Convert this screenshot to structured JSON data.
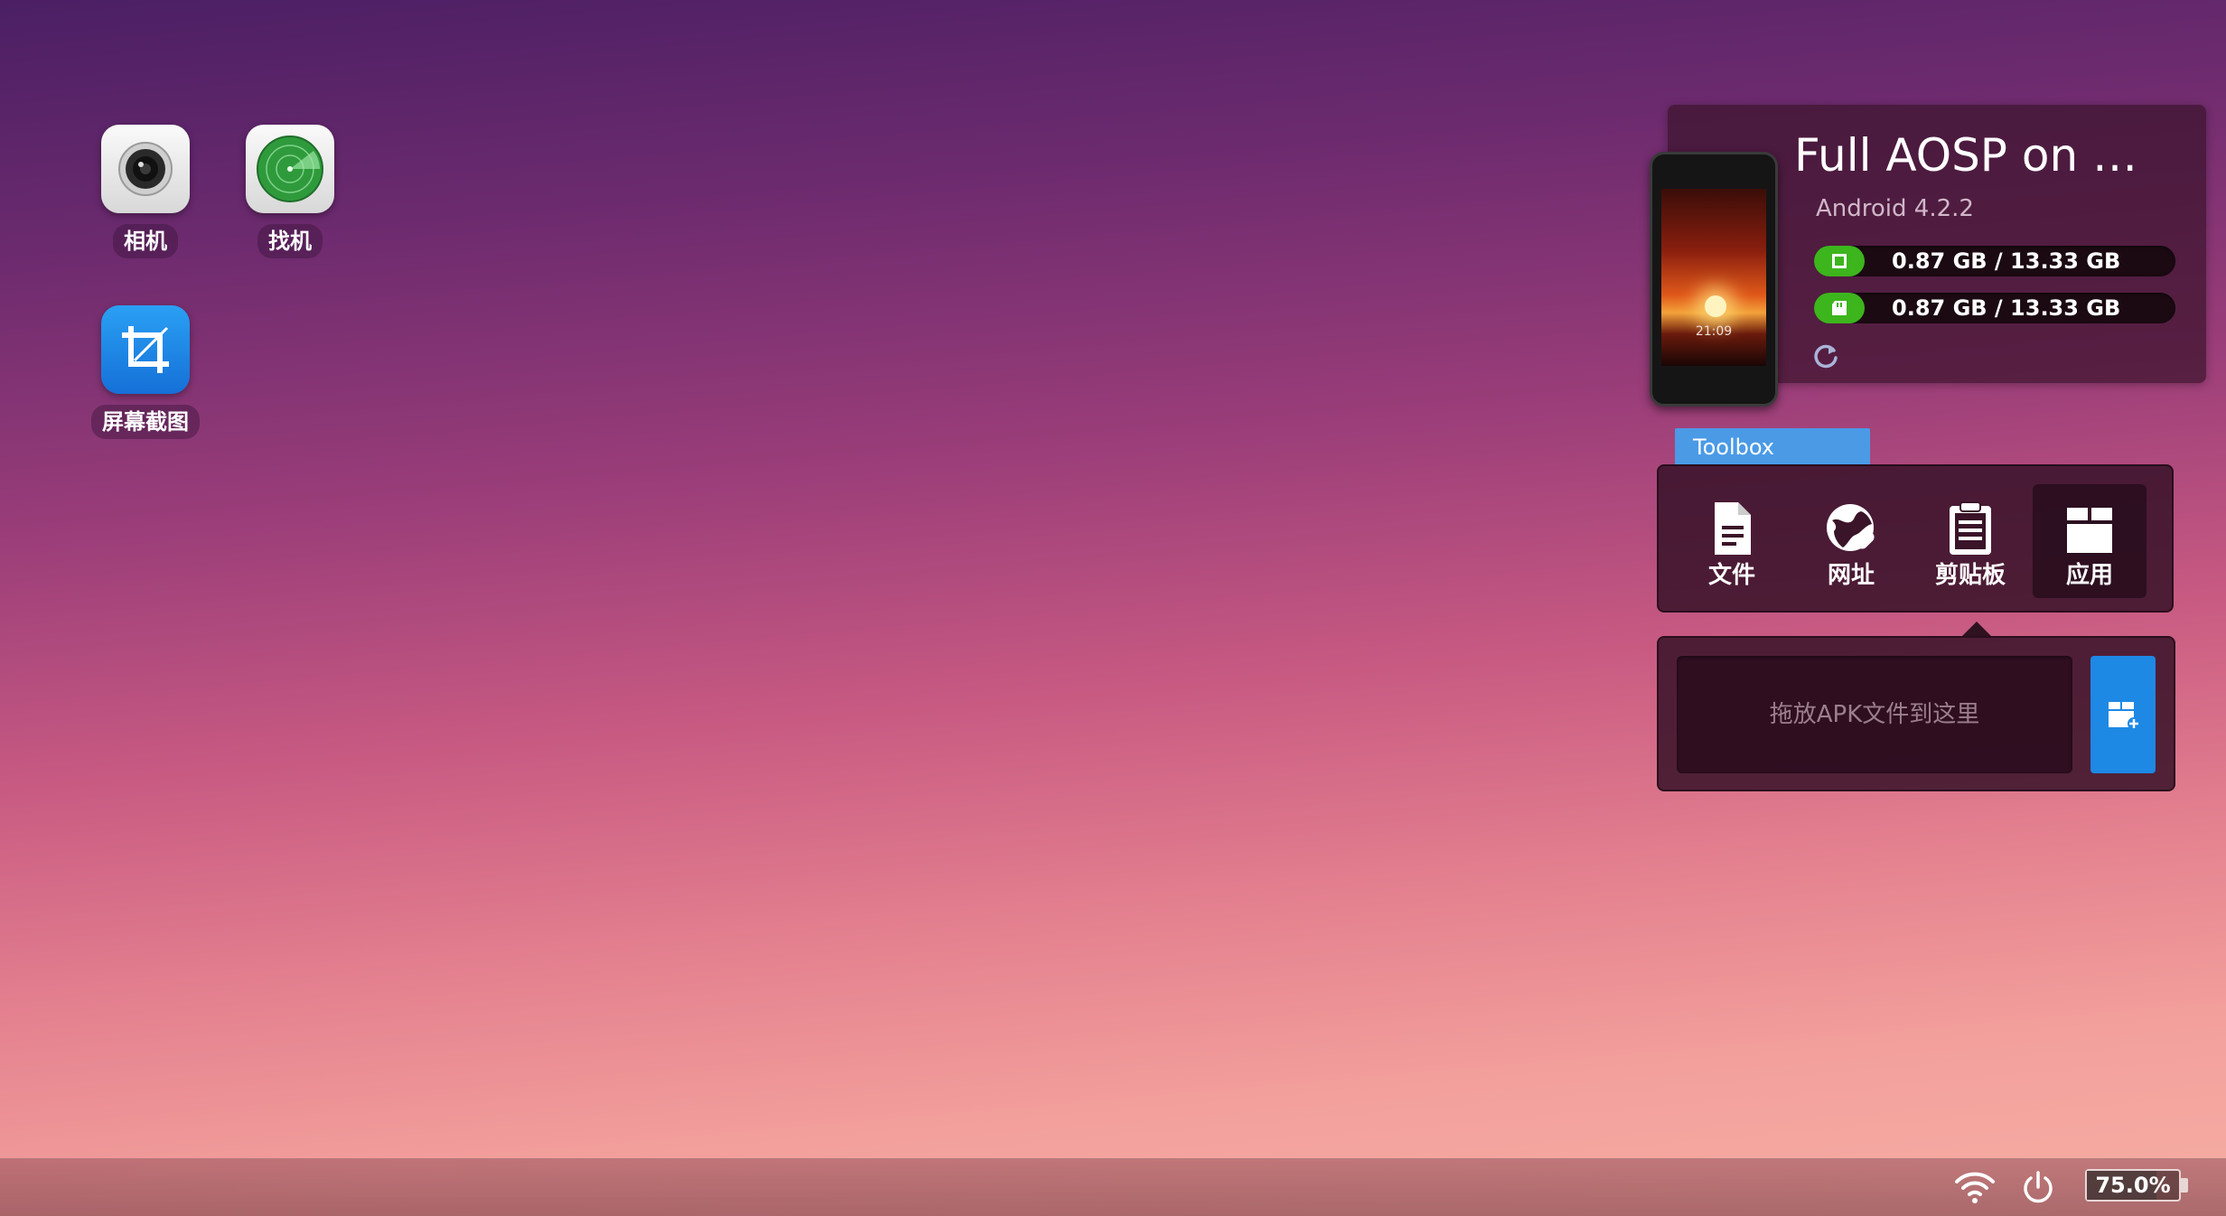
{
  "desktop": {
    "icons": [
      {
        "label": "相机",
        "icon": "camera-icon"
      },
      {
        "label": "找机",
        "icon": "radar-icon"
      },
      {
        "label": "屏幕截图",
        "icon": "crop-icon"
      }
    ]
  },
  "device": {
    "name": "Full AOSP on M…",
    "os_version": "Android 4.2.2",
    "storage": [
      {
        "text": "0.87 GB / 13.33 GB",
        "icon": "phone-storage-icon",
        "used_fraction": 0.065
      },
      {
        "text": "0.87 GB / 13.33 GB",
        "icon": "sd-card-icon",
        "used_fraction": 0.065
      }
    ],
    "phone_clock": "21:09",
    "refresh_icon": "refresh-icon"
  },
  "toolbox": {
    "tab_label": "Toolbox",
    "tools": [
      {
        "label": "文件",
        "icon": "file-icon"
      },
      {
        "label": "网址",
        "icon": "globe-link-icon"
      },
      {
        "label": "剪贴板",
        "icon": "clipboard-icon"
      },
      {
        "label": "应用",
        "icon": "app-box-icon",
        "active": true
      }
    ],
    "apk_drop_placeholder": "拖放APK文件到这里",
    "apk_add_icon": "add-app-icon"
  },
  "taskbar": {
    "wifi_icon": "wifi-icon",
    "power_icon": "power-icon",
    "battery_text": "75.0%",
    "battery_level": 0.75
  },
  "colors": {
    "accent_blue": "#1e88e5",
    "toolbox_tab": "#4a9ae6",
    "storage_green": "#3db51d"
  }
}
